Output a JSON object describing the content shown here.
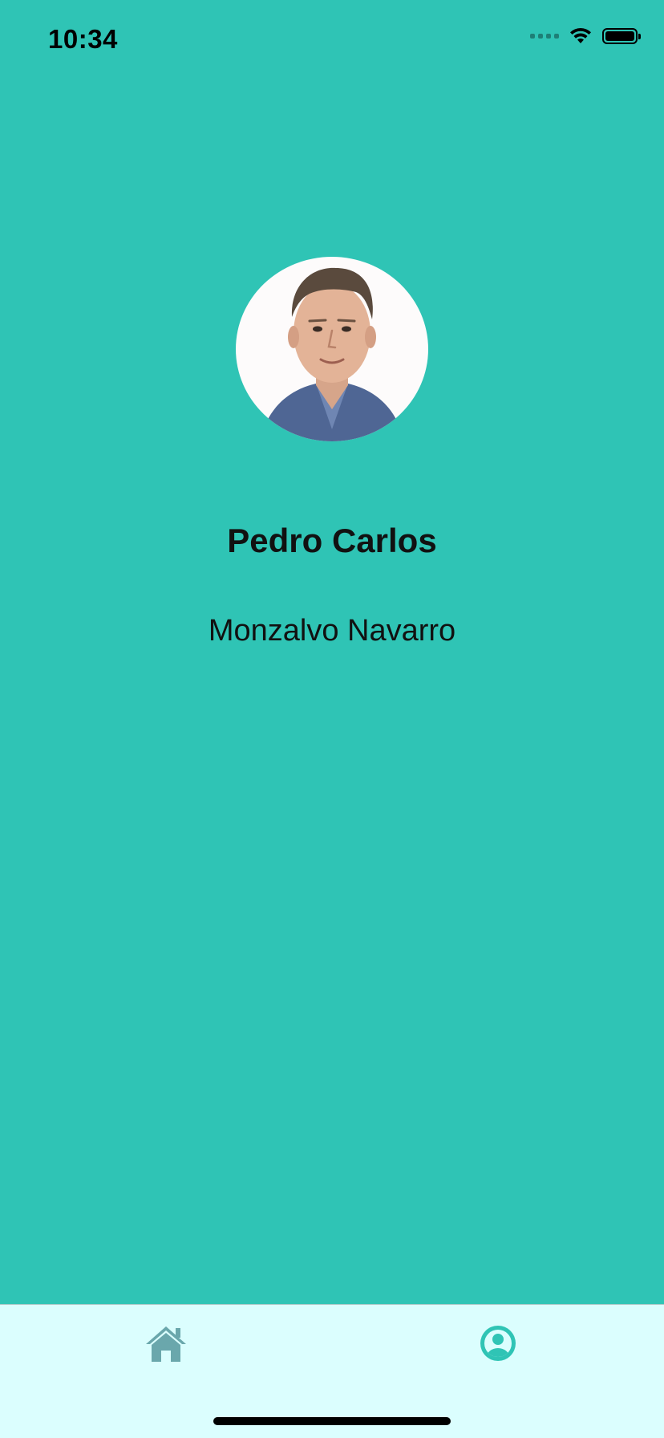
{
  "status_bar": {
    "time": "10:34"
  },
  "profile": {
    "first_name": "Pedro Carlos",
    "last_name": "Monzalvo Navarro",
    "avatar_icon": "avatar-photo"
  },
  "tab_bar": {
    "items": [
      {
        "icon": "home-icon",
        "active": false
      },
      {
        "icon": "profile-icon",
        "active": true
      }
    ]
  },
  "colors": {
    "background": "#2fc4b5",
    "tab_bar_background": "#dbfefe",
    "tab_inactive": "#6aa7ac",
    "tab_active": "#2fc4b5"
  }
}
